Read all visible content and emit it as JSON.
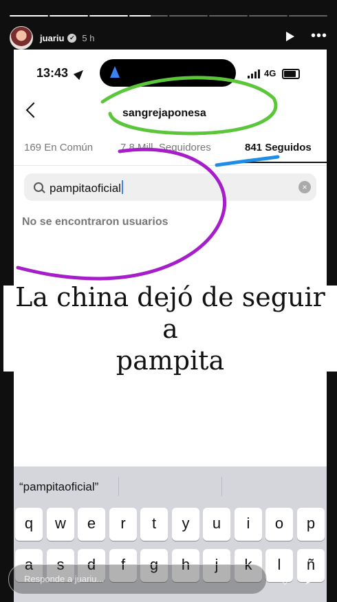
{
  "story": {
    "username": "juariu",
    "time": "5 h",
    "verified_mark": "✔",
    "play_icon": "play-icon",
    "more_icon": "more-icon"
  },
  "phone": {
    "clock": "13:43",
    "network": "4G",
    "profile_title": "sangrejaponesa",
    "tabs": [
      {
        "label": "169 En Común"
      },
      {
        "label": "7,8 Mill. Seguidores"
      },
      {
        "label": "841 Seguidos"
      }
    ],
    "search": {
      "value": "pampitaoficial"
    },
    "empty": "No se encontraron usuarios",
    "suggestion": "“pampitaoficial”"
  },
  "caption": {
    "line1": "La china dejó de seguir a",
    "line2": "pampita"
  },
  "keyboard": {
    "row1": [
      "q",
      "w",
      "e",
      "r",
      "t",
      "y",
      "u",
      "i",
      "o",
      "p"
    ],
    "row2": [
      "a",
      "s",
      "d",
      "f",
      "g",
      "h",
      "j",
      "k",
      "l",
      "ñ"
    ]
  },
  "reply": {
    "placeholder": "Responde a juariu..."
  },
  "colors": {
    "green": "#5cc63b",
    "blue": "#1d8de8",
    "purple": "#a61ec9"
  }
}
